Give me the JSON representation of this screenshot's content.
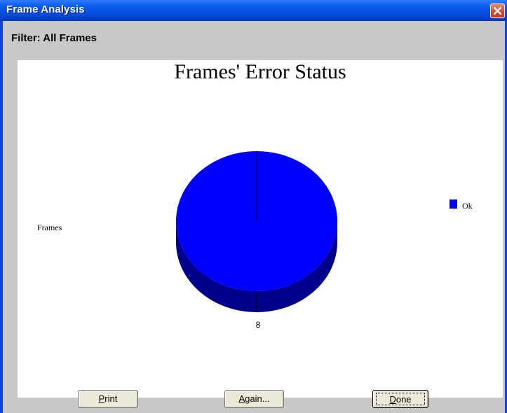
{
  "window": {
    "title": "Frame Analysis",
    "close_icon": "close-icon"
  },
  "filter": {
    "label": "Filter: All Frames"
  },
  "chart_data": {
    "type": "pie",
    "title": "Frames' Error Status",
    "ylabel": "Frames",
    "slices": [
      {
        "label": "Ok",
        "value": 8,
        "color": "#0000ff"
      }
    ],
    "data_labels": [
      "8"
    ],
    "legend": {
      "placement": "right",
      "entries": [
        "Ok"
      ]
    },
    "style": "3d"
  },
  "buttons": {
    "print_mnemonic": "P",
    "print_rest": "rint",
    "again_mnemonic": "A",
    "again_rest": "gain...",
    "done_mnemonic": "D",
    "done_rest": "one"
  }
}
